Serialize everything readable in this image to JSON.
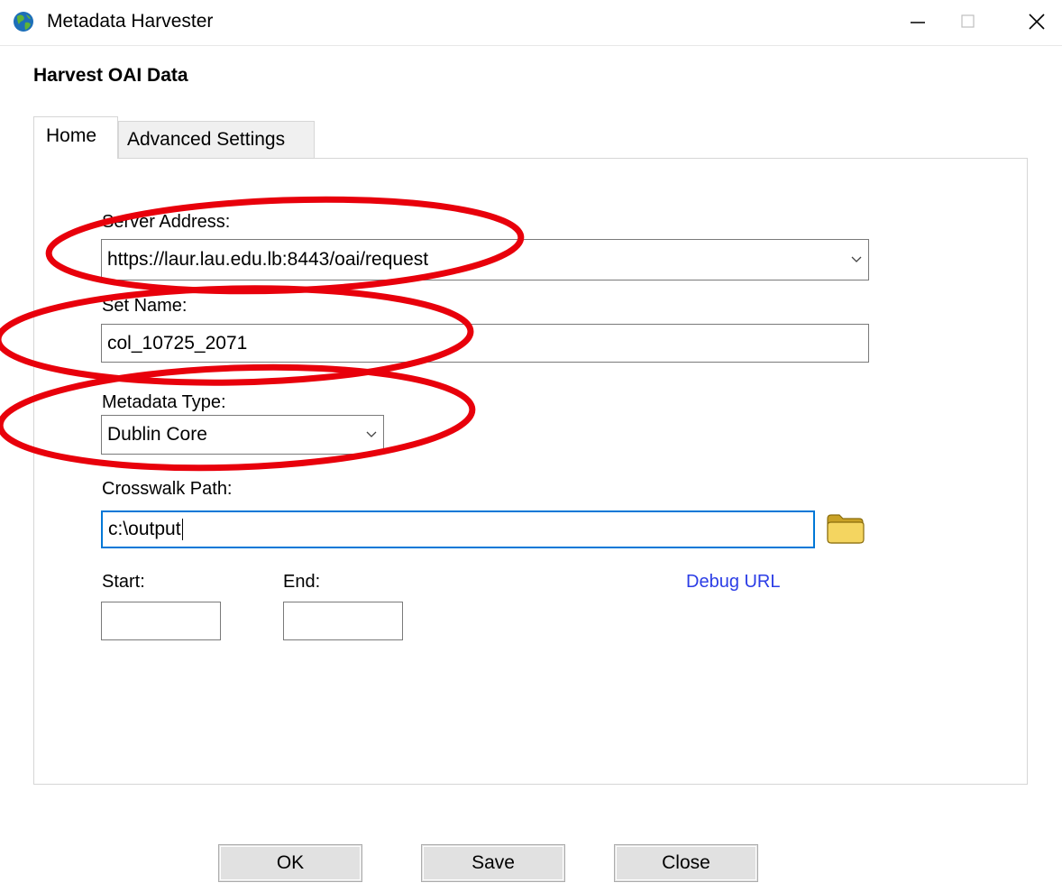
{
  "window": {
    "title": "Metadata Harvester",
    "controls": {
      "minimize": "minimize-icon",
      "maximize": "maximize-icon",
      "close": "close-icon"
    }
  },
  "header": "Harvest OAI Data",
  "tabs": [
    {
      "label": "Home",
      "selected": true
    },
    {
      "label": "Advanced Settings",
      "selected": false
    }
  ],
  "form": {
    "server_address": {
      "label": "Server Address:",
      "value": "https://laur.lau.edu.lb:8443/oai/request"
    },
    "set_name": {
      "label": "Set Name:",
      "value": "col_10725_2071"
    },
    "metadata_type": {
      "label": "Metadata Type:",
      "value": "Dublin Core"
    },
    "crosswalk_path": {
      "label": "Crosswalk Path:",
      "value": "c:\\output"
    },
    "start": {
      "label": "Start:",
      "value": ""
    },
    "end": {
      "label": "End:",
      "value": ""
    },
    "debug_link": "Debug URL"
  },
  "buttons": {
    "ok": "OK",
    "save": "Save",
    "close": "Close"
  },
  "colors": {
    "annotation": "#e8000b",
    "link": "#2b3de6",
    "focus": "#0078d7"
  }
}
